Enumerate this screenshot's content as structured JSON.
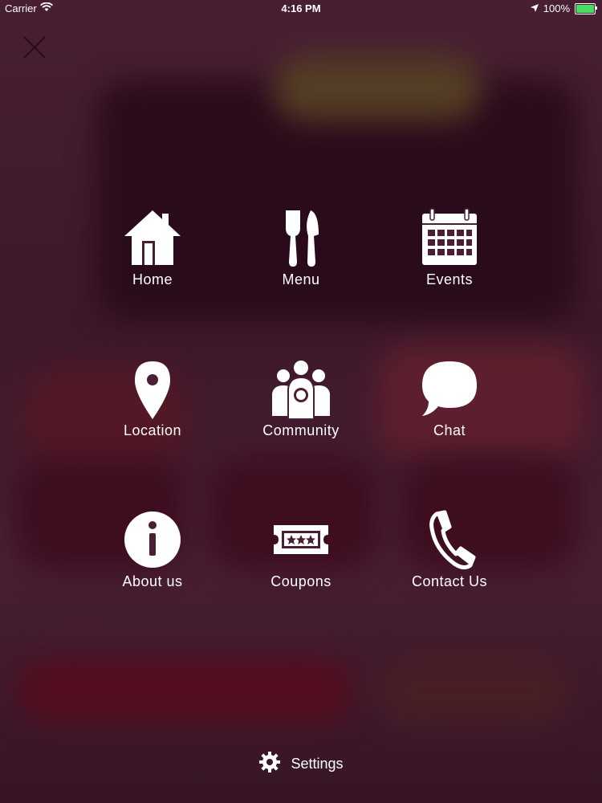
{
  "status_bar": {
    "carrier": "Carrier",
    "time": "4:16 PM",
    "battery": "100%"
  },
  "menu": {
    "items": [
      {
        "label": "Home",
        "icon": "home-icon"
      },
      {
        "label": "Menu",
        "icon": "fork-knife-icon"
      },
      {
        "label": "Events",
        "icon": "calendar-icon"
      },
      {
        "label": "Location",
        "icon": "map-pin-icon"
      },
      {
        "label": "Community",
        "icon": "community-icon"
      },
      {
        "label": "Chat",
        "icon": "chat-bubble-icon"
      },
      {
        "label": "About us",
        "icon": "info-icon"
      },
      {
        "label": "Coupons",
        "icon": "ticket-icon"
      },
      {
        "label": "Contact Us",
        "icon": "phone-icon"
      }
    ]
  },
  "settings": {
    "label": "Settings",
    "icon": "gear-icon"
  },
  "colors": {
    "overlay": "#3a1428",
    "text": "#ffffff"
  }
}
